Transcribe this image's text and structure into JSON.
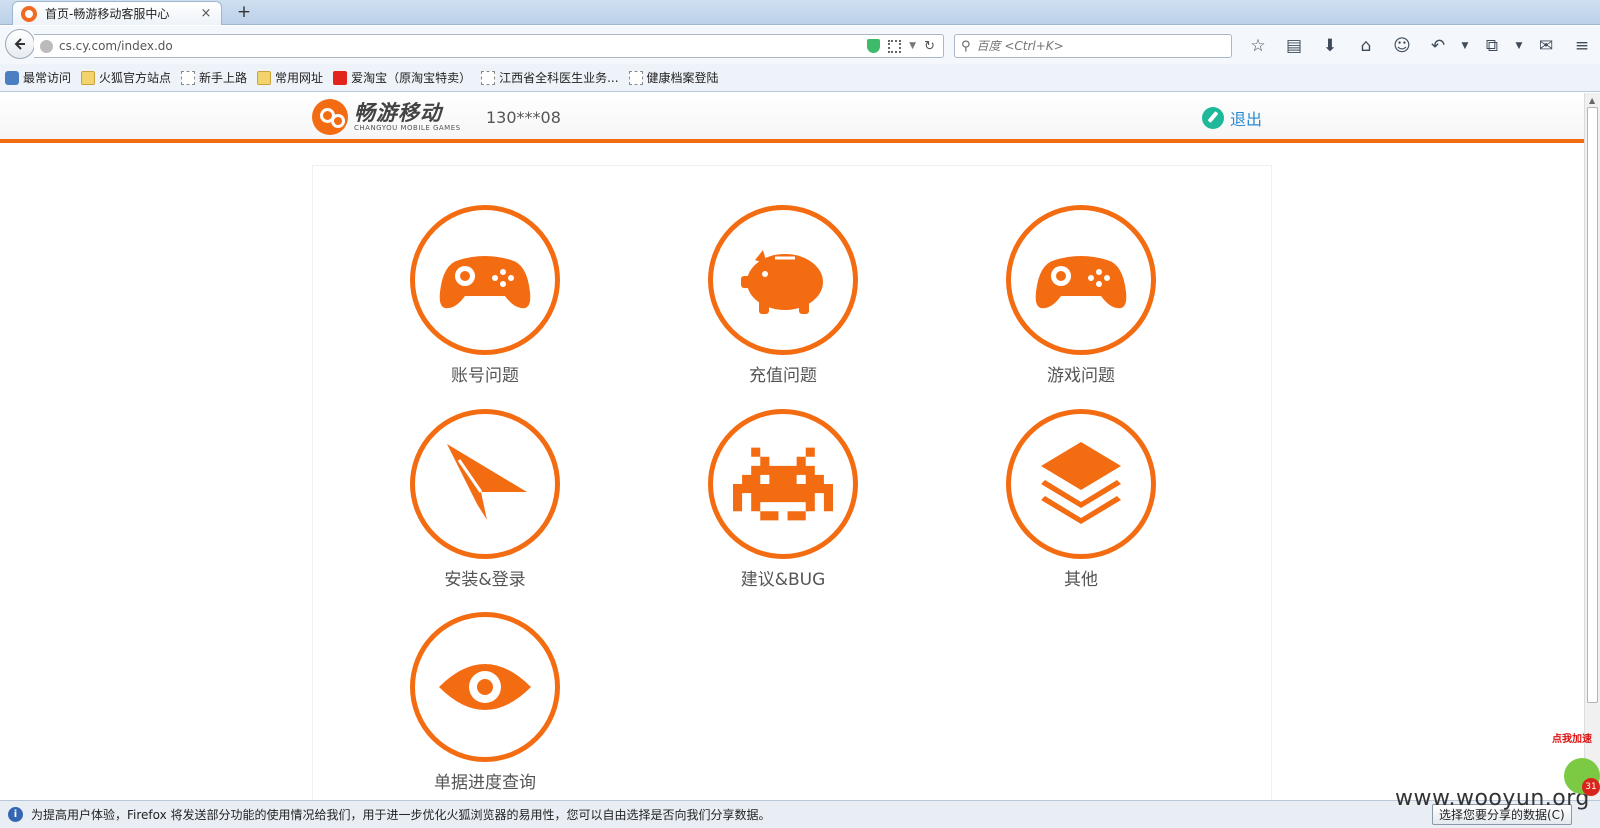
{
  "browser": {
    "tab_title": "首页-畅游移动客服中心",
    "tab_close": "×",
    "new_tab": "+",
    "url": "cs.cy.com/index.do",
    "search_placeholder": "百度 <Ctrl+K>",
    "bookmarks": [
      {
        "label": "最常访问",
        "icon": "search"
      },
      {
        "label": "火狐官方站点",
        "icon": "folder"
      },
      {
        "label": "新手上路",
        "icon": "page"
      },
      {
        "label": "常用网址",
        "icon": "folder"
      },
      {
        "label": "爱淘宝（原淘宝特卖）",
        "icon": "taobao"
      },
      {
        "label": "江西省全科医生业务...",
        "icon": "page"
      },
      {
        "label": "健康档案登陆",
        "icon": "page"
      }
    ]
  },
  "header": {
    "logo_cn": "畅游移动",
    "logo_en": "CHANGYOU MOBILE GAMES",
    "user_phone": "130***08",
    "logout": "退出"
  },
  "menu": {
    "accent_color": "#f46c12",
    "items": [
      {
        "label": "账号问题",
        "icon": "gamepad-icon"
      },
      {
        "label": "充值问题",
        "icon": "piggy-bank-icon"
      },
      {
        "label": "游戏问题",
        "icon": "gamepad-icon"
      },
      {
        "label": "安装&登录",
        "icon": "paper-plane-icon"
      },
      {
        "label": "建议&BUG",
        "icon": "space-invader-icon"
      },
      {
        "label": "其他",
        "icon": "layers-icon"
      },
      {
        "label": "单据进度查询",
        "icon": "eye-icon"
      }
    ]
  },
  "notification": {
    "message": "为提高用户体验，Firefox 将发送部分功能的使用情况给我们，用于进一步优化火狐浏览器的易用性，您可以自由选择是否向我们分享数据。",
    "button": "选择您要分享的数据(C)"
  },
  "overlay": {
    "watermark": "www.wooyun.org",
    "speedup_label": "点我加速",
    "speedup_badge": "31"
  }
}
